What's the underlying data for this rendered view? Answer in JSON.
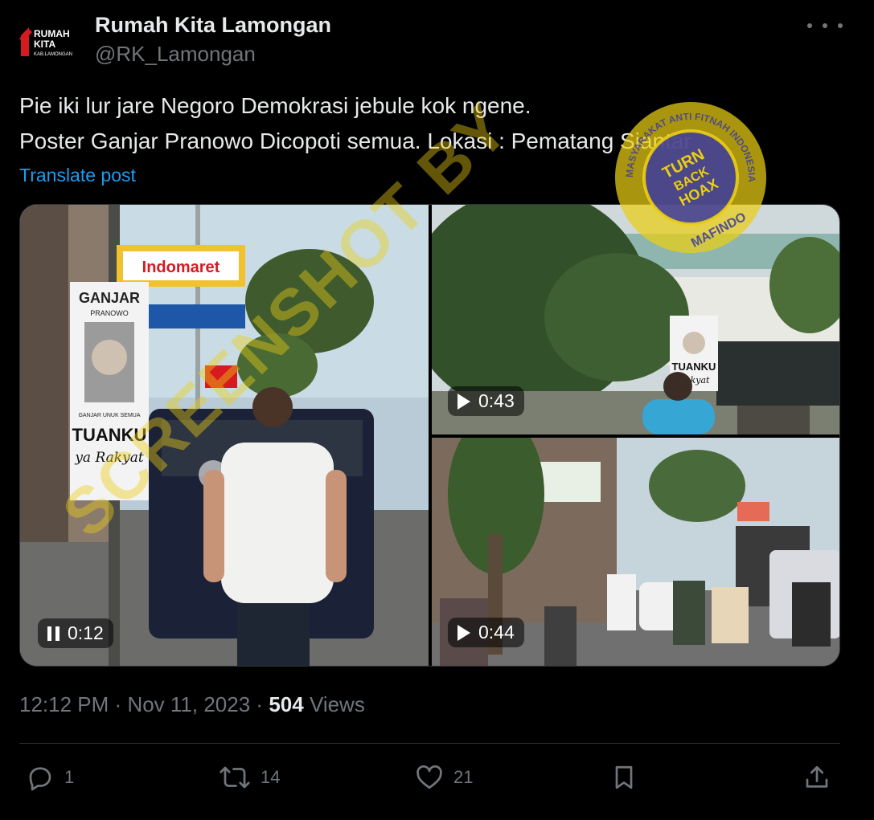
{
  "author": {
    "name": "Rumah Kita Lamongan",
    "handle": "@RK_Lamongan",
    "logo_text": [
      "RUMAH",
      "KITA",
      "KAB.LAMONGAN"
    ]
  },
  "post": {
    "lines": [
      "Pie iki lur jare Negoro Demokrasi jebule kok ngene.",
      "Poster Ganjar Pranowo Dicopoti semua. Lokasi : Pematang Siantar"
    ],
    "translate_label": "Translate post"
  },
  "media": {
    "videos": [
      {
        "duration": "0:12",
        "state": "playing"
      },
      {
        "duration": "0:43",
        "state": "paused"
      },
      {
        "duration": "0:44",
        "state": "paused"
      }
    ],
    "scene_text": {
      "store_sign": "Indomaret",
      "poster_heading": "GANJAR",
      "poster_sub": "PRANOWO",
      "poster_main": "TUANKU",
      "poster_script": "ya Rakyat",
      "poster_small": "GANJAR UNUK SEMUA",
      "clip2_poster_main": "TUANKU",
      "clip2_poster_script": "Rakyat"
    }
  },
  "meta": {
    "time": "12:12 PM",
    "separator": "·",
    "date": "Nov 11, 2023",
    "views_count": "504",
    "views_label": "Views"
  },
  "actions": {
    "replies": "1",
    "reposts": "14",
    "likes": "21"
  },
  "watermark": {
    "text": "SCREENSHOT BY",
    "seal_text": [
      "TURN",
      "BACK",
      "HOAX"
    ],
    "seal_ring": "MASYARAKAT ANTI FITNAH INDONESIA",
    "seal_bottom": "MAFINDO"
  },
  "colors": {
    "background": "#000000",
    "text": "#e7e9ea",
    "muted": "#71767b",
    "link": "#1d9bf0",
    "watermark": "#ecce14",
    "seal_inner": "#3b3a9e",
    "indomaret_red": "#d71920",
    "indomaret_blue": "#1e57a8"
  },
  "icons": [
    "reply-icon",
    "repost-icon",
    "like-icon",
    "bookmark-icon",
    "share-icon",
    "more-icon",
    "play-icon",
    "pause-icon"
  ]
}
